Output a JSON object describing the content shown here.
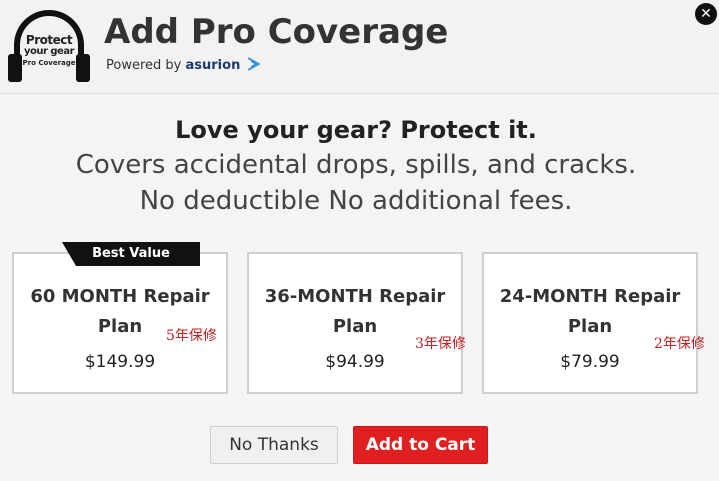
{
  "header": {
    "logo": {
      "line1": "Protect",
      "line2": "your gear",
      "line3": "Pro Coverage"
    },
    "title": "Add Pro Coverage",
    "powered_by": "Powered by",
    "brand": "asurion",
    "close_glyph": "✕"
  },
  "pitch": {
    "headline": "Love your gear? Protect it.",
    "line1": "Covers accidental drops, spills, and cracks.",
    "line2": "No deductible No additional fees."
  },
  "plans": [
    {
      "name_line1": "60 MONTH Repair",
      "name_line2": "Plan",
      "price": "$149.99",
      "badge": "Best Value",
      "note": "5年保修"
    },
    {
      "name_line1": "36-MONTH Repair",
      "name_line2": "Plan",
      "price": "$94.99",
      "note": "3年保修"
    },
    {
      "name_line1": "24-MONTH Repair",
      "name_line2": "Plan",
      "price": "$79.99",
      "note": "2年保修"
    }
  ],
  "actions": {
    "no_thanks": "No Thanks",
    "add_to_cart": "Add to Cart"
  },
  "colors": {
    "accent": "#e02020",
    "brand": "#1d3b6e",
    "note": "#c21f1f"
  }
}
